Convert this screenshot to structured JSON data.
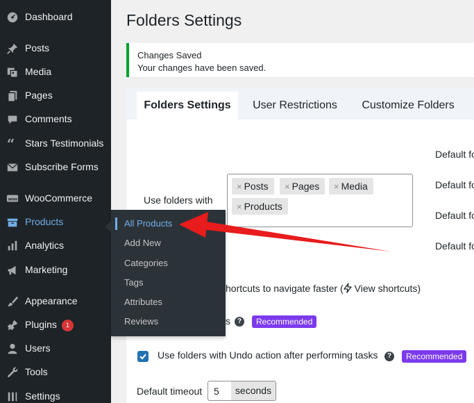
{
  "sidebar": {
    "items": [
      {
        "label": "Dashboard",
        "icon": "dashboard-icon"
      },
      {
        "label": "Posts",
        "icon": "pin-icon"
      },
      {
        "label": "Media",
        "icon": "media-icon"
      },
      {
        "label": "Pages",
        "icon": "pages-icon"
      },
      {
        "label": "Comments",
        "icon": "comment-icon"
      },
      {
        "label": "Stars Testimonials",
        "icon": "quote-icon"
      },
      {
        "label": "Subscribe Forms",
        "icon": "envelope-icon"
      },
      {
        "label": "WooCommerce",
        "icon": "woo-icon"
      },
      {
        "label": "Products",
        "icon": "archive-icon"
      },
      {
        "label": "Analytics",
        "icon": "bar-chart-icon"
      },
      {
        "label": "Marketing",
        "icon": "megaphone-icon"
      },
      {
        "label": "Appearance",
        "icon": "brush-icon"
      },
      {
        "label": "Plugins",
        "icon": "plug-icon",
        "badge": "1"
      },
      {
        "label": "Users",
        "icon": "user-icon"
      },
      {
        "label": "Tools",
        "icon": "wrench-icon"
      },
      {
        "label": "Settings",
        "icon": "settings-icon"
      }
    ],
    "flyout": [
      "All Products",
      "Add New",
      "Categories",
      "Tags",
      "Attributes",
      "Reviews"
    ]
  },
  "page": {
    "title": "Folders Settings",
    "notice": {
      "title": "Changes Saved",
      "body": "Your changes have been saved."
    },
    "tabs": [
      "Folders Settings",
      "User Restrictions",
      "Customize Folders"
    ],
    "use_folders_label": "Use folders with",
    "chips": [
      "Posts",
      "Pages",
      "Media",
      "Products"
    ],
    "default_labels": [
      "Default fo",
      "Default fo",
      "Default fo",
      "Default fo"
    ],
    "shortcuts_text": "hortcuts to navigate faster (",
    "shortcuts_link": "View shortcuts)",
    "partial_s": "s",
    "recommended": "Recommended",
    "undo_label": "Use folders with Undo action after performing tasks",
    "timeout_label": "Default timeout",
    "timeout_value": "5",
    "timeout_unit": "seconds"
  },
  "colors": {
    "sidebar_bg": "#1d2327",
    "accent": "#72aee6",
    "notice_border": "#00a32a",
    "badge_purple": "#7c3aed",
    "arrow": "#e81c1c"
  }
}
